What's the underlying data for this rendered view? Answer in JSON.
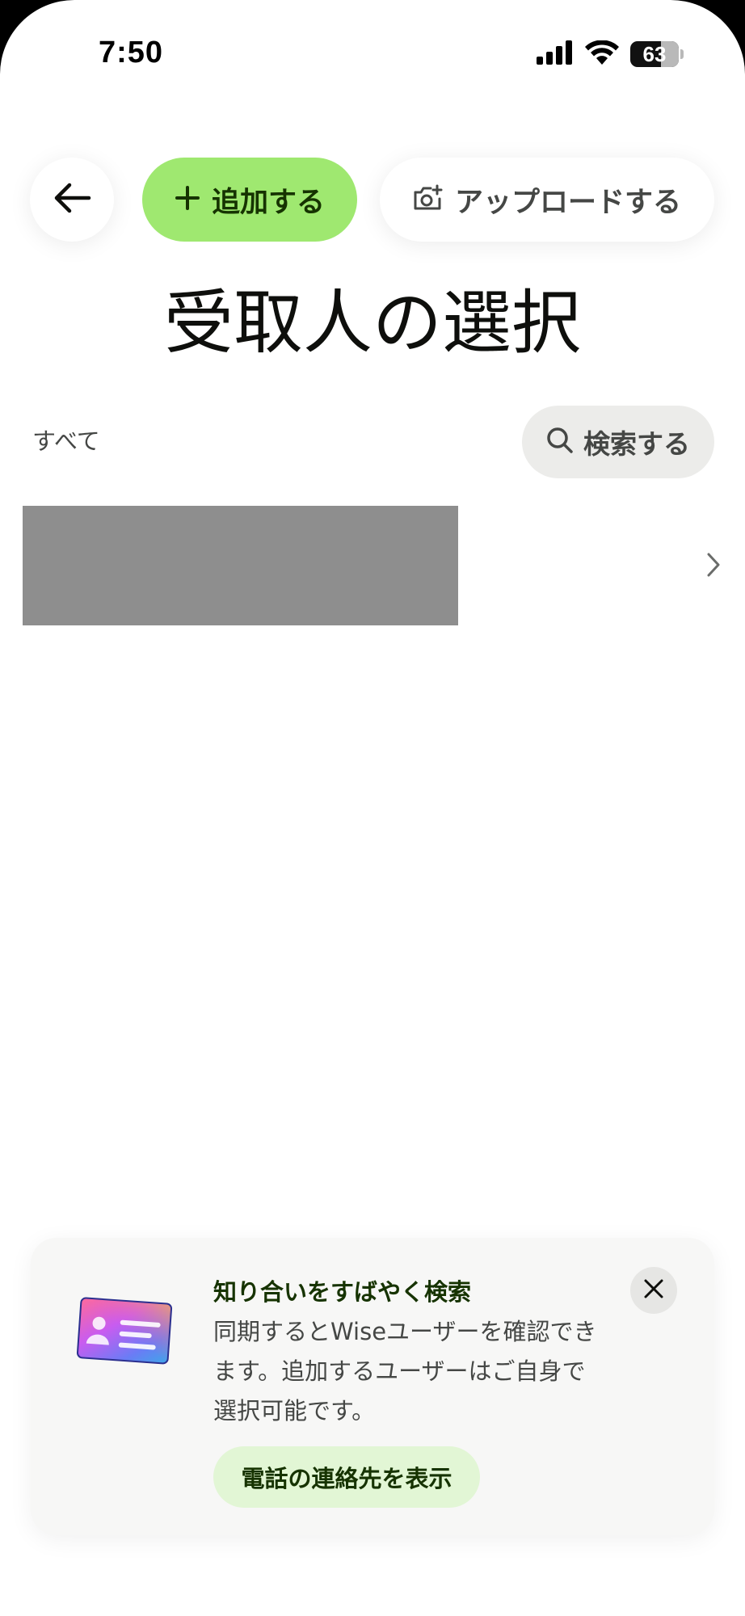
{
  "status_bar": {
    "time": "7:50",
    "battery": "63",
    "battery_percent": 63,
    "icons": [
      "cellular-signal-icon",
      "wifi-icon",
      "battery-icon"
    ]
  },
  "toolbar": {
    "back_icon": "arrow-left-icon",
    "add_label": "追加する",
    "add_icon": "plus-icon",
    "upload_label": "アップロードする",
    "upload_icon": "camera-plus-icon"
  },
  "page": {
    "title": "受取人の選択"
  },
  "filter": {
    "label": "すべて",
    "search_label": "検索する",
    "search_icon": "search-icon"
  },
  "recipients": [
    {
      "name": "",
      "redacted": true,
      "chevron_icon": "chevron-right-icon"
    }
  ],
  "sync_card": {
    "title": "知り合いをすばやく検索",
    "body": "同期するとWiseユーザーを確認できます。追加するユーザーはご自身で選択可能です。",
    "button_label": "電話の連絡先を表示",
    "close_icon": "close-icon",
    "illustration": "contact-card-illustration"
  },
  "colors": {
    "primary_green": "#9fe870",
    "dark_green": "#163300",
    "light_green": "#e2f6d5",
    "text_primary": "#0e0f0c",
    "text_secondary": "#454745",
    "search_bg": "#ececea",
    "card_bg": "#f7f7f6",
    "redacted": "#8e8e8e"
  }
}
